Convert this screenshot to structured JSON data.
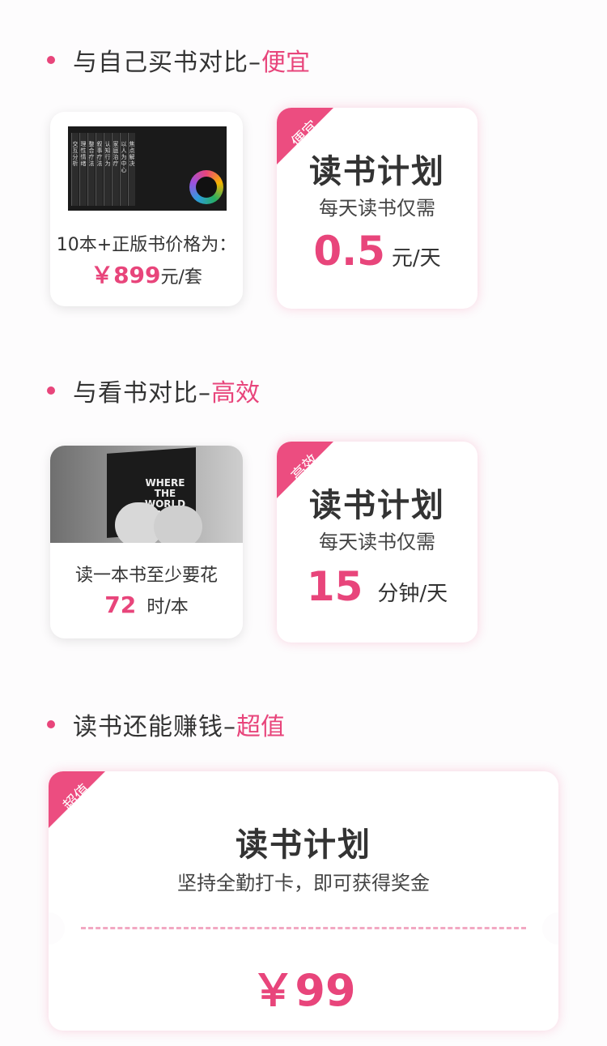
{
  "section1": {
    "heading": "与自己买书对比–",
    "accent": "便宜",
    "book_card": {
      "caption": "10本+正版书价格为：",
      "price": "￥899",
      "unit": "元/套",
      "spines": [
        "家庭治疗",
        "焦点解决",
        "以人为中心",
        "认知行为",
        "叙事疗法",
        "整合疗法",
        "理性情绪",
        "交互分析"
      ]
    },
    "plan": {
      "badge": "便宜",
      "title": "读书计划",
      "subtitle": "每天读书仅需",
      "value": "0.5",
      "unit": "元/天"
    }
  },
  "section2": {
    "heading": "与看书对比–",
    "accent": "高效",
    "photo_card": {
      "book_cover_text": "WHERE THE WORLD ENDS",
      "caption": "读一本书至少要花",
      "value": "72",
      "unit": "时/本"
    },
    "plan": {
      "badge": "高效",
      "title": "读书计划",
      "subtitle": "每天读书仅需",
      "value": "15",
      "unit": "分钟/天"
    }
  },
  "section3": {
    "heading": "读书还能赚钱–",
    "accent": "超值",
    "ticket": {
      "badge": "超值",
      "title": "读书计划",
      "subtitle": "坚持全勤打卡，即可获得奖金",
      "price": "￥99"
    }
  },
  "colors": {
    "accent": "#e8457b",
    "text": "#333333",
    "dash": "#f2a8c2"
  }
}
